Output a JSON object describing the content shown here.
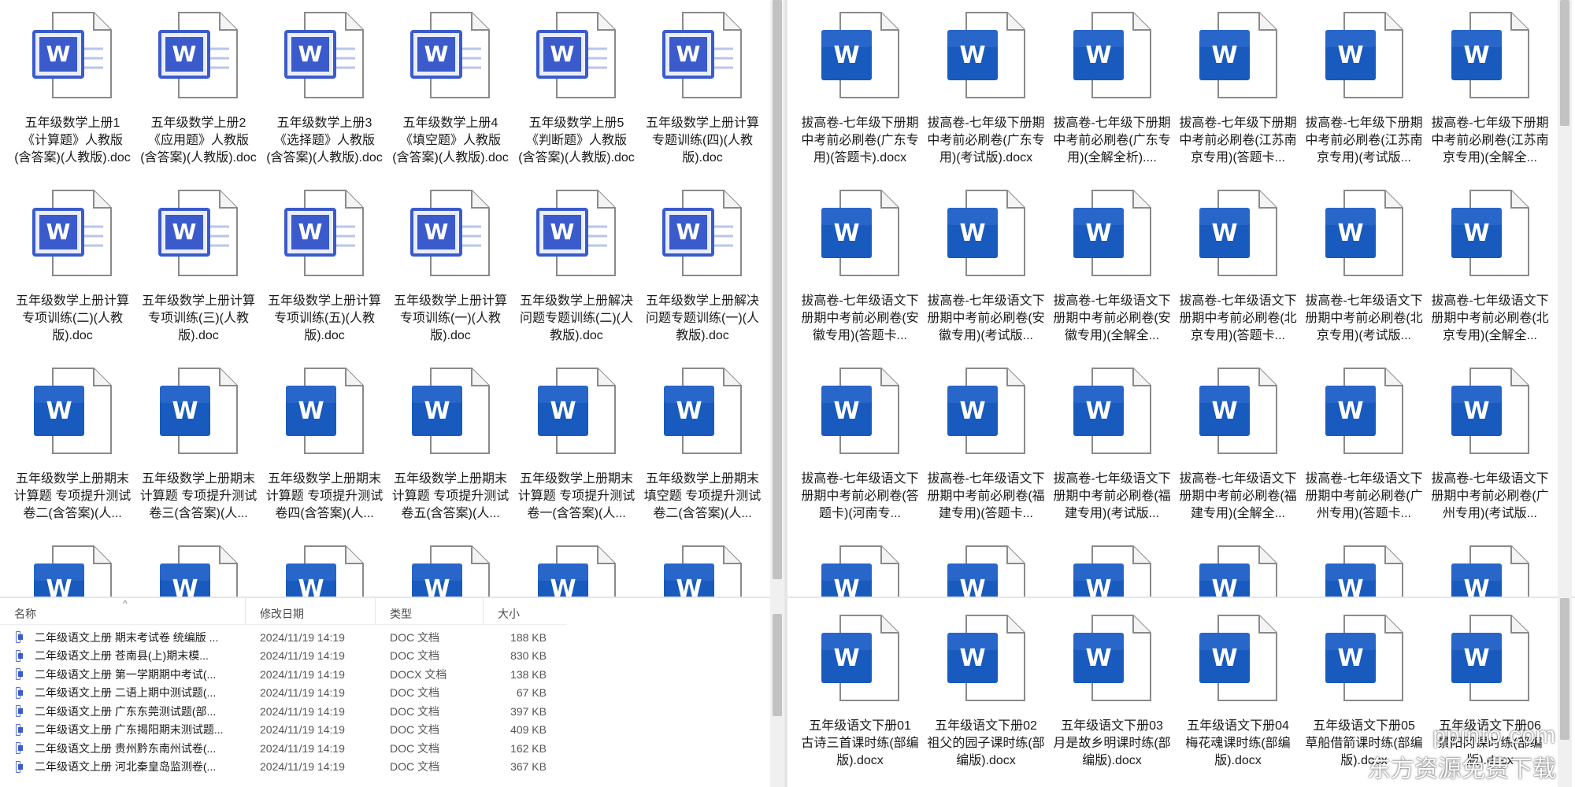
{
  "top_left": {
    "files": [
      {
        "label": "五年级数学上册1《计算题》人教版 (含答案)(人教版).doc",
        "style": "classic"
      },
      {
        "label": "五年级数学上册2《应用题》人教版 (含答案)(人教版).doc",
        "style": "classic"
      },
      {
        "label": "五年级数学上册3《选择题》人教版 (含答案)(人教版).doc",
        "style": "classic"
      },
      {
        "label": "五年级数学上册4《填空题》人教版 (含答案)(人教版).doc",
        "style": "classic"
      },
      {
        "label": "五年级数学上册5《判断题》人教版 (含答案)(人教版).doc",
        "style": "classic"
      },
      {
        "label": "五年级数学上册计算专题训练(四)(人教版).doc",
        "style": "classic"
      },
      {
        "label": "五年级数学上册计算专项训练(二)(人教版).doc",
        "style": "classic"
      },
      {
        "label": "五年级数学上册计算专项训练(三)(人教版).doc",
        "style": "classic"
      },
      {
        "label": "五年级数学上册计算专项训练(五)(人教版).doc",
        "style": "classic"
      },
      {
        "label": "五年级数学上册计算专项训练(一)(人教版).doc",
        "style": "classic"
      },
      {
        "label": "五年级数学上册解决问题专题训练(二)(人教版).doc",
        "style": "classic"
      },
      {
        "label": "五年级数学上册解决问题专题训练(一)(人教版).doc",
        "style": "classic"
      },
      {
        "label": "五年级数学上册期末 计算题 专项提升测试卷二(含答案)(人...",
        "style": "modern"
      },
      {
        "label": "五年级数学上册期末 计算题 专项提升测试卷三(含答案)(人...",
        "style": "modern"
      },
      {
        "label": "五年级数学上册期末 计算题 专项提升测试卷四(含答案)(人...",
        "style": "modern"
      },
      {
        "label": "五年级数学上册期末 计算题 专项提升测试卷五(含答案)(人...",
        "style": "modern"
      },
      {
        "label": "五年级数学上册期末 计算题 专项提升测试卷一(含答案)(人...",
        "style": "modern"
      },
      {
        "label": "五年级数学上册期末 填空题 专项提升测试卷二(含答案)(人...",
        "style": "modern"
      },
      {
        "label": "",
        "style": "modern"
      },
      {
        "label": "",
        "style": "modern"
      },
      {
        "label": "",
        "style": "modern"
      },
      {
        "label": "",
        "style": "modern"
      },
      {
        "label": "",
        "style": "modern"
      },
      {
        "label": "",
        "style": "modern"
      }
    ]
  },
  "top_right": {
    "files": [
      {
        "label": "拔高卷-七年级下册期中考前必刷卷(广东专用)(答题卡).docx",
        "style": "modern"
      },
      {
        "label": "拔高卷-七年级下册期中考前必刷卷(广东专用)(考试版).docx",
        "style": "modern"
      },
      {
        "label": "拔高卷-七年级下册期中考前必刷卷(广东专用)(全解全析)....",
        "style": "modern"
      },
      {
        "label": "拔高卷-七年级下册期中考前必刷卷(江苏南京专用)(答题卡...",
        "style": "modern"
      },
      {
        "label": "拔高卷-七年级下册期中考前必刷卷(江苏南京专用)(考试版...",
        "style": "modern"
      },
      {
        "label": "拔高卷-七年级下册期中考前必刷卷(江苏南京专用)(全解全...",
        "style": "modern"
      },
      {
        "label": "拔高卷-七年级语文下册期中考前必刷卷(安徽专用)(答题卡...",
        "style": "modern"
      },
      {
        "label": "拔高卷-七年级语文下册期中考前必刷卷(安徽专用)(考试版...",
        "style": "modern"
      },
      {
        "label": "拔高卷-七年级语文下册期中考前必刷卷(安徽专用)(全解全...",
        "style": "modern"
      },
      {
        "label": "拔高卷-七年级语文下册期中考前必刷卷(北京专用)(答题卡...",
        "style": "modern"
      },
      {
        "label": "拔高卷-七年级语文下册期中考前必刷卷(北京专用)(考试版...",
        "style": "modern"
      },
      {
        "label": "拔高卷-七年级语文下册期中考前必刷卷(北京专用)(全解全...",
        "style": "modern"
      },
      {
        "label": "拔高卷-七年级语文下册期中考前必刷卷(答题卡)(河南专...",
        "style": "modern"
      },
      {
        "label": "拔高卷-七年级语文下册期中考前必刷卷(福建专用)(答题卡...",
        "style": "modern"
      },
      {
        "label": "拔高卷-七年级语文下册期中考前必刷卷(福建专用)(考试版...",
        "style": "modern"
      },
      {
        "label": "拔高卷-七年级语文下册期中考前必刷卷(福建专用)(全解全...",
        "style": "modern"
      },
      {
        "label": "拔高卷-七年级语文下册期中考前必刷卷(广州专用)(答题卡...",
        "style": "modern"
      },
      {
        "label": "拔高卷-七年级语文下册期中考前必刷卷(广州专用)(考试版...",
        "style": "modern"
      },
      {
        "label": "",
        "style": "modern"
      },
      {
        "label": "",
        "style": "modern"
      },
      {
        "label": "",
        "style": "modern"
      },
      {
        "label": "",
        "style": "modern"
      },
      {
        "label": "",
        "style": "modern"
      },
      {
        "label": "",
        "style": "modern"
      }
    ]
  },
  "bottom_right": {
    "files": [
      {
        "label": "五年级语文下册01 古诗三首课时练(部编版).docx",
        "style": "modern"
      },
      {
        "label": "五年级语文下册02 祖父的园子课时练(部编版).docx",
        "style": "modern"
      },
      {
        "label": "五年级语文下册03 月是故乡明课时练(部编版).docx",
        "style": "modern"
      },
      {
        "label": "五年级语文下册04 梅花魂课时练(部编版).docx",
        "style": "modern"
      },
      {
        "label": "五年级语文下册05 草船借箭课时练(部编版).docx",
        "style": "modern"
      },
      {
        "label": "五年级语文下册06 景阳冈课时练(部编版).docx",
        "style": "modern"
      }
    ]
  },
  "details": {
    "columns": {
      "name": "名称",
      "date": "修改日期",
      "type": "类型",
      "size": "大小"
    },
    "sort_indicator": "^",
    "rows": [
      {
        "name": "二年级语文上册   期末考试卷  统编版 ...",
        "date": "2024/11/19 14:19",
        "type": "DOC 文档",
        "size": "188 KB"
      },
      {
        "name": "二年级语文上册   苍南县(上)期末模...",
        "date": "2024/11/19 14:19",
        "type": "DOC 文档",
        "size": "830 KB"
      },
      {
        "name": "二年级语文上册   第一学期期中考试(...",
        "date": "2024/11/19 14:19",
        "type": "DOCX 文档",
        "size": "138 KB"
      },
      {
        "name": "二年级语文上册   二语上期中测试题(...",
        "date": "2024/11/19 14:19",
        "type": "DOC 文档",
        "size": "67 KB"
      },
      {
        "name": "二年级语文上册   广东东莞测试题(部...",
        "date": "2024/11/19 14:19",
        "type": "DOC 文档",
        "size": "397 KB"
      },
      {
        "name": "二年级语文上册   广东揭阳期末测试题...",
        "date": "2024/11/19 14:19",
        "type": "DOC 文档",
        "size": "409 KB"
      },
      {
        "name": "二年级语文上册   贵州黔东南州试卷(...",
        "date": "2024/11/19 14:19",
        "type": "DOC 文档",
        "size": "162 KB"
      },
      {
        "name": "二年级语文上册   河北秦皇岛监测卷(...",
        "date": "2024/11/19 14:19",
        "type": "DOC 文档",
        "size": "367 KB"
      }
    ]
  },
  "watermark": {
    "line1": "ppinfo.com",
    "line2": "东方资源免费下载"
  },
  "colors": {
    "word_blue": "#185abd",
    "word_blue_light": "#4a7fe0",
    "classic_border": "#3b5bcc"
  }
}
